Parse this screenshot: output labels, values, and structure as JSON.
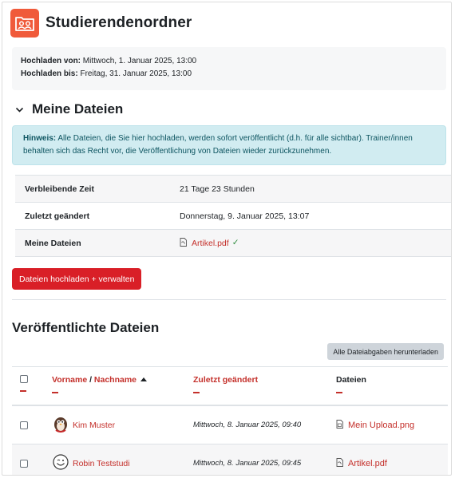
{
  "page": {
    "title": "Studierendenordner"
  },
  "dates": {
    "open_label": "Hochladen von:",
    "open_value": "Mittwoch, 1. Januar 2025, 13:00",
    "close_label": "Hochladen bis:",
    "close_value": "Freitag, 31. Januar 2025, 13:00"
  },
  "my_files": {
    "section_title": "Meine Dateien",
    "notice_label": "Hinweis:",
    "notice_text": " Alle Dateien, die Sie hier hochladen, werden sofort veröffentlicht (d.h. für alle sichtbar). Trainer/innen behalten sich das Recht vor, die Veröffentlichung von Dateien wieder zurückzunehmen.",
    "rows": [
      {
        "label": "Verbleibende Zeit",
        "value": "21 Tage 23 Stunden"
      },
      {
        "label": "Zuletzt geändert",
        "value": "Donnerstag, 9. Januar 2025, 13:07"
      },
      {
        "label": "Meine Dateien",
        "file": "Artikel.pdf"
      }
    ],
    "upload_button": "Dateien hochladen + verwalten"
  },
  "published": {
    "title": "Veröffentlichte Dateien",
    "download_all": "Alle Dateiabgaben herunterladen",
    "headers": {
      "first_name": "Vorname",
      "separator": " / ",
      "last_name": "Nachname",
      "modified": "Zuletzt geändert",
      "files": "Dateien"
    },
    "rows": [
      {
        "name": "Kim Muster",
        "modified": "Mittwoch, 8. Januar 2025, 09:40",
        "file": "Mein Upload.png",
        "file_icon": "image-file-icon",
        "avatar": "penguin-avatar"
      },
      {
        "name": "Robin Teststudi",
        "modified": "Mittwoch, 8. Januar 2025, 09:45",
        "file": "Artikel.pdf",
        "file_icon": "pdf-file-icon",
        "avatar": "smiley-avatar"
      }
    ]
  },
  "colors": {
    "accent": "#d91f27",
    "link": "#c4302b",
    "module_icon": "#f05a3a",
    "notice_bg": "#d1ecf1"
  }
}
